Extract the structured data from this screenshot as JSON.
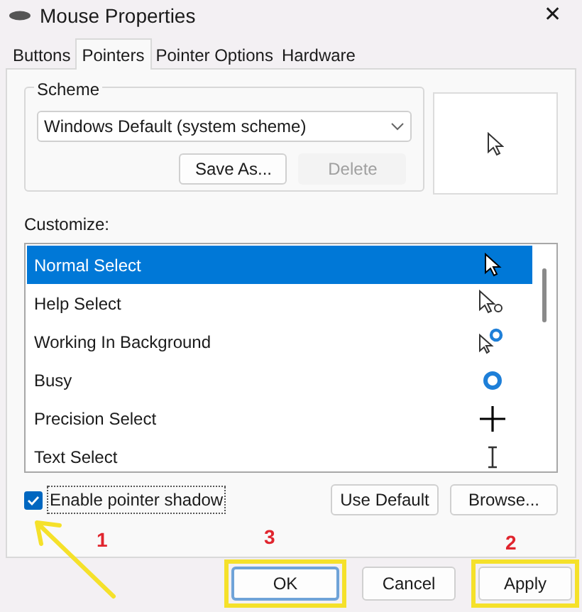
{
  "window": {
    "title": "Mouse Properties",
    "close": "✕"
  },
  "tabs": [
    {
      "label": "Buttons",
      "selected": false
    },
    {
      "label": "Pointers",
      "selected": true
    },
    {
      "label": "Pointer Options",
      "selected": false
    },
    {
      "label": "Hardware",
      "selected": false
    }
  ],
  "scheme": {
    "label": "Scheme",
    "value": "Windows Default (system scheme)",
    "buttons": [
      {
        "label": "Save As...",
        "disabled": false
      },
      {
        "label": "Delete",
        "disabled": true
      }
    ]
  },
  "customize": {
    "label": "Customize:",
    "items": [
      {
        "label": "Normal Select",
        "selected": true,
        "kind": "arrow"
      },
      {
        "label": "Help Select",
        "selected": false,
        "kind": "help"
      },
      {
        "label": "Working In Background",
        "selected": false,
        "kind": "working"
      },
      {
        "label": "Busy",
        "selected": false,
        "kind": "busy"
      },
      {
        "label": "Precision Select",
        "selected": false,
        "kind": "cross"
      },
      {
        "label": "Text Select",
        "selected": false,
        "kind": "beam"
      }
    ]
  },
  "shadow": {
    "label": "Enable pointer shadow",
    "checked": true
  },
  "side_buttons": [
    "Use Default",
    "Browse..."
  ],
  "buttons": [
    {
      "label": "OK",
      "highlighted": true
    },
    {
      "label": "Cancel",
      "highlighted": false
    },
    {
      "label": "Apply",
      "highlighted": true
    }
  ],
  "annotations": [
    {
      "text": "1"
    },
    {
      "text": "3"
    },
    {
      "text": "2"
    }
  ]
}
